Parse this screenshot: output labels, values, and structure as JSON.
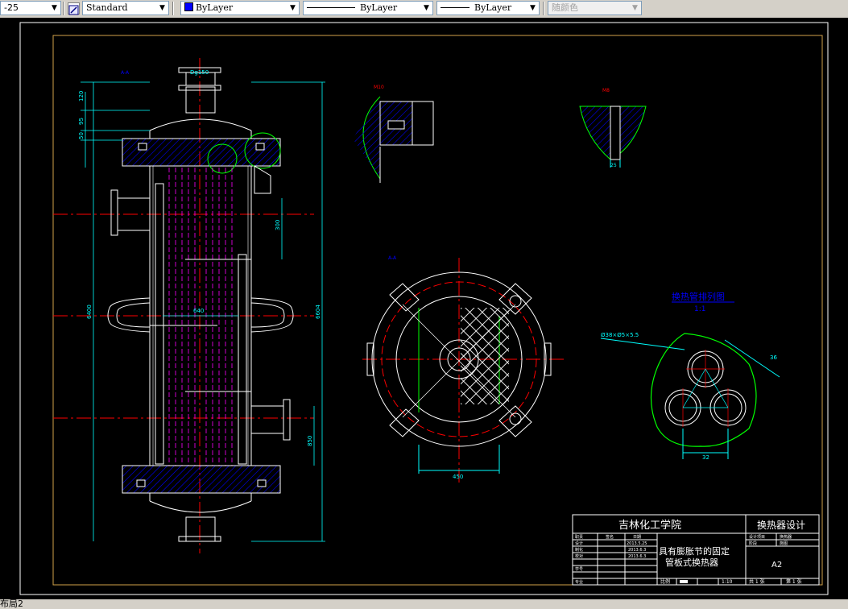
{
  "toolbar": {
    "scale_value": "-25",
    "text_style": "Standard",
    "layer_color": "ByLayer",
    "linetype": "ByLayer",
    "lineweight": "ByLayer",
    "plot_style": "随颜色",
    "colors": {
      "layer_swatch": "#0000ff"
    }
  },
  "drawing": {
    "labels": {
      "top_nozzle": "Dg150",
      "dim_120": "120",
      "dim_95": "95",
      "dim_50": "50",
      "dim_300": "300",
      "dim_640": "640",
      "dim_6400": "6400",
      "dim_6604": "6604",
      "dim_850": "850",
      "dim_450": "450",
      "dim_36": "36",
      "dim_32": "32",
      "dim_25": "25",
      "tube_spec": "Ø38×Ø5×5.5",
      "detail_b": "B",
      "layout_title": "换热管排列图",
      "layout_scale": "1:1",
      "detail_1": "M10",
      "detail_2": "M8",
      "section_aa": "A-A"
    },
    "colors": {
      "outline": "#ffffff",
      "dimension": "#00ffff",
      "centerline": "#ff0000",
      "hatch": "#0000ff",
      "detail": "#00ff00",
      "label": "#ff00ff",
      "frame": "#ffff00"
    }
  },
  "title_block": {
    "institution": "吉林化工学院",
    "project": "换热器设计",
    "drawing_name_line1": "具有膨胀节的固定",
    "drawing_name_line2": "管板式换热器",
    "sheet_size": "A2",
    "rows": [
      {
        "role": "职责",
        "name": "签名",
        "date": "日期"
      },
      {
        "role": "设计",
        "name": "",
        "date": "2013.5.25"
      },
      {
        "role": "制化",
        "name": "",
        "date": "2013.6.3"
      },
      {
        "role": "校对",
        "name": "",
        "date": "2013.6.3"
      },
      {
        "role": "学号",
        "name": "",
        "date": ""
      },
      {
        "role": "专业",
        "name": "",
        "date": ""
      }
    ],
    "right_top": {
      "a": "设计项目",
      "b": "换热器",
      "c": "阶段",
      "d": "施图"
    },
    "bottom": {
      "ratio_label": "比例",
      "ratio": "1:10",
      "total": "共 1 张",
      "sheet": "第 1 张"
    }
  },
  "status": {
    "layout_tab": "布局2"
  }
}
